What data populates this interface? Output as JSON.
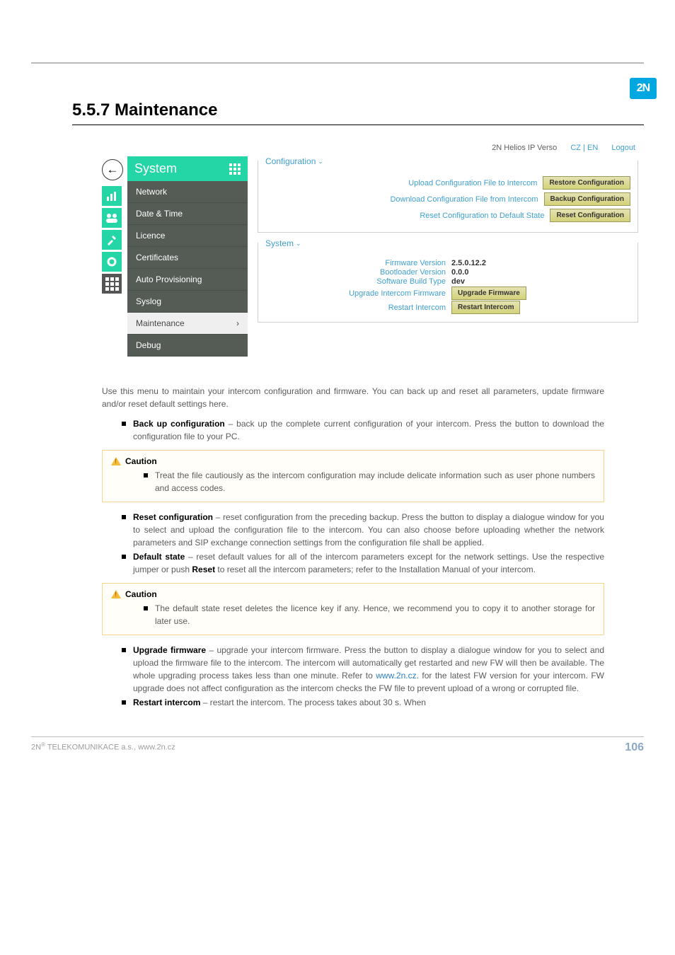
{
  "page": {
    "logo_text": "2N",
    "title": "5.5.7 Maintenance",
    "footer_left": "2N® TELEKOMUNIKACE a.s., www.2n.cz",
    "footer_page": "106"
  },
  "app": {
    "product": "2N Helios IP Verso",
    "lang_switch": "CZ | EN",
    "logout": "Logout",
    "back_glyph": "←",
    "sidebar": {
      "title": "System",
      "items": [
        {
          "label": "Network"
        },
        {
          "label": "Date & Time"
        },
        {
          "label": "Licence"
        },
        {
          "label": "Certificates"
        },
        {
          "label": "Auto Provisioning"
        },
        {
          "label": "Syslog"
        },
        {
          "label": "Maintenance",
          "active": true,
          "chev": "›"
        },
        {
          "label": "Debug"
        }
      ]
    },
    "icons": [
      "chart",
      "users",
      "tools",
      "gear",
      "grid"
    ],
    "panels": {
      "config": {
        "legend": "Configuration",
        "rows": [
          {
            "label": "Upload Configuration File to Intercom",
            "button": "Restore Configuration"
          },
          {
            "label": "Download Configuration File from Intercom",
            "button": "Backup Configuration"
          },
          {
            "label": "Reset Configuration to Default State",
            "button": "Reset Configuration"
          }
        ]
      },
      "system": {
        "legend": "System",
        "info": [
          {
            "label": "Firmware Version",
            "value": "2.5.0.12.2"
          },
          {
            "label": "Bootloader Version",
            "value": "0.0.0"
          },
          {
            "label": "Software Build Type",
            "value": "dev"
          }
        ],
        "actions": [
          {
            "label": "Upgrade Intercom Firmware",
            "button": "Upgrade Firmware"
          },
          {
            "label": "Restart Intercom",
            "button": "Restart Intercom"
          }
        ]
      }
    }
  },
  "body": {
    "intro": "Use this menu to maintain your intercom configuration and firmware. You can back up and reset all parameters, update firmware and/or reset default settings here.",
    "bul1_strong": "Back up configuration",
    "bul1_rest": " – back up the complete current configuration of your intercom. Press the button to download the configuration file to your PC.",
    "caution_label": "Caution",
    "caution1": "Treat the file cautiously as the intercom configuration may include delicate information such as user phone numbers and access codes.",
    "bul2_strong": "Reset configuration",
    "bul2_rest": " – reset configuration from the preceding backup. Press the button to display a dialogue window for you to select and upload the configuration file to the intercom. You can also choose before uploading whether the network parameters and SIP exchange connection settings from the configuration file shall be applied.",
    "bul3_strong": "Default state",
    "bul3_rest_a": " – reset default values for all of the intercom parameters except for the network settings. Use the respective jumper or push ",
    "bul3_reset": "Reset",
    "bul3_rest_b": " to reset all the intercom parameters; refer to the Installation Manual of your intercom.",
    "caution2": "The default state reset deletes the licence key if any. Hence, we recommend you to copy it to another storage for later use.",
    "bul4_strong": "Upgrade firmware",
    "bul4_rest_a": " – upgrade your intercom firmware. Press the button to display a dialogue window for you to select and upload the firmware file to the intercom. The intercom will automatically get restarted and new FW will then be available. The whole upgrading process takes less than one minute. Refer to  ",
    "bul4_link": "www.2n.cz",
    "bul4_rest_b": ". for the latest FW version for your intercom. FW upgrade does not affect configuration as the intercom checks the FW file to prevent upload of a wrong or corrupted file.",
    "bul5_strong": "Restart intercom",
    "bul5_rest": " – restart the intercom. The process takes about 30 s. When"
  }
}
